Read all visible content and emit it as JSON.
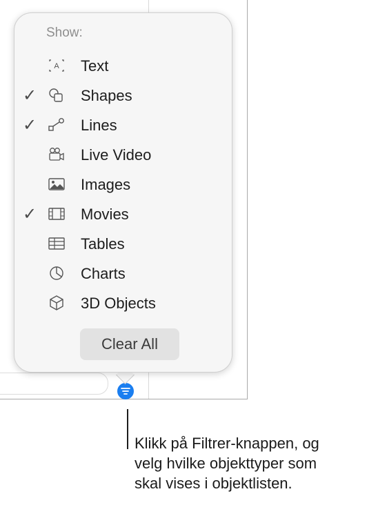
{
  "popover": {
    "header": "Show:",
    "items": [
      {
        "label": "Text",
        "checked": false,
        "icon": "text-box-icon"
      },
      {
        "label": "Shapes",
        "checked": true,
        "icon": "shapes-icon"
      },
      {
        "label": "Lines",
        "checked": true,
        "icon": "lines-icon"
      },
      {
        "label": "Live Video",
        "checked": false,
        "icon": "live-video-icon"
      },
      {
        "label": "Images",
        "checked": false,
        "icon": "image-icon"
      },
      {
        "label": "Movies",
        "checked": true,
        "icon": "film-icon"
      },
      {
        "label": "Tables",
        "checked": false,
        "icon": "table-icon"
      },
      {
        "label": "Charts",
        "checked": false,
        "icon": "pie-chart-icon"
      },
      {
        "label": "3D Objects",
        "checked": false,
        "icon": "cube-icon"
      }
    ],
    "check_glyph": "✓",
    "clear_all": "Clear All"
  },
  "filter_button": {
    "icon": "filter-icon",
    "color": "#1a7ef0"
  },
  "callout": {
    "lines": [
      "Klikk på Filtrer-knappen, og",
      "velg hvilke objekttyper som",
      "skal vises i objektlisten."
    ]
  }
}
